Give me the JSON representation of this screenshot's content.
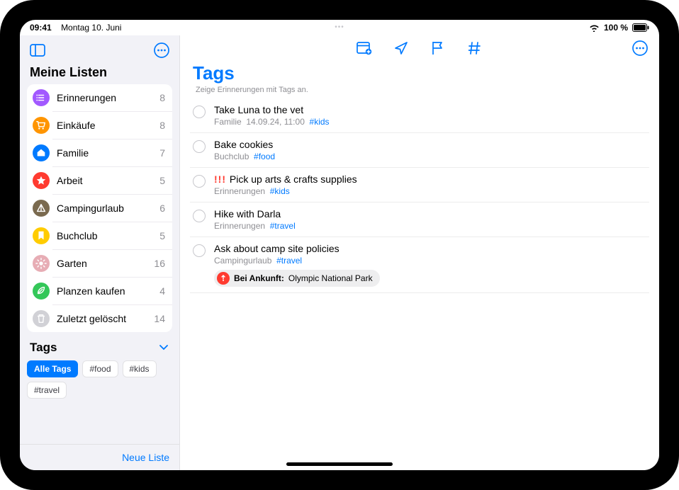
{
  "status": {
    "time": "09:41",
    "date": "Montag 10. Juni",
    "battery": "100 %"
  },
  "sidebar": {
    "header": "Meine Listen",
    "lists": [
      {
        "name": "Erinnerungen",
        "count": "8",
        "color": "#a259ff",
        "icon": "list"
      },
      {
        "name": "Einkäufe",
        "count": "8",
        "color": "#ff9500",
        "icon": "cart"
      },
      {
        "name": "Familie",
        "count": "7",
        "color": "#007aff",
        "icon": "house"
      },
      {
        "name": "Arbeit",
        "count": "5",
        "color": "#ff3b30",
        "icon": "star"
      },
      {
        "name": "Campingurlaub",
        "count": "6",
        "color": "#7a6a4f",
        "icon": "tent"
      },
      {
        "name": "Buchclub",
        "count": "5",
        "color": "#ffcc00",
        "icon": "bookmark"
      },
      {
        "name": "Garten",
        "count": "16",
        "color": "#e7adb5",
        "icon": "sun"
      },
      {
        "name": "Planzen kaufen",
        "count": "4",
        "color": "#34c759",
        "icon": "leaf"
      },
      {
        "name": "Zuletzt gelöscht",
        "count": "14",
        "color": "#d1d1d6",
        "icon": "trash"
      }
    ],
    "tags_header": "Tags",
    "tags": [
      {
        "label": "Alle Tags",
        "active": true
      },
      {
        "label": "#food",
        "active": false
      },
      {
        "label": "#kids",
        "active": false
      },
      {
        "label": "#travel",
        "active": false
      }
    ],
    "new_list": "Neue Liste"
  },
  "main": {
    "title": "Tags",
    "subtitle": "Zeige Erinnerungen mit Tags an.",
    "reminders": [
      {
        "title": "Take Luna to the vet",
        "list": "Familie",
        "extra": "14.09.24, 11:00",
        "tag": "#kids"
      },
      {
        "title": "Bake cookies",
        "list": "Buchclub",
        "extra": "",
        "tag": "#food"
      },
      {
        "title": "Pick up arts & crafts supplies",
        "priority": "!!!",
        "list": "Erinnerungen",
        "extra": "",
        "tag": "#kids"
      },
      {
        "title": "Hike with Darla",
        "list": "Erinnerungen",
        "extra": "",
        "tag": "#travel"
      },
      {
        "title": "Ask about camp site policies",
        "list": "Campingurlaub",
        "extra": "",
        "tag": "#travel",
        "location": {
          "label": "Bei Ankunft:",
          "value": "Olympic National Park"
        }
      }
    ]
  }
}
